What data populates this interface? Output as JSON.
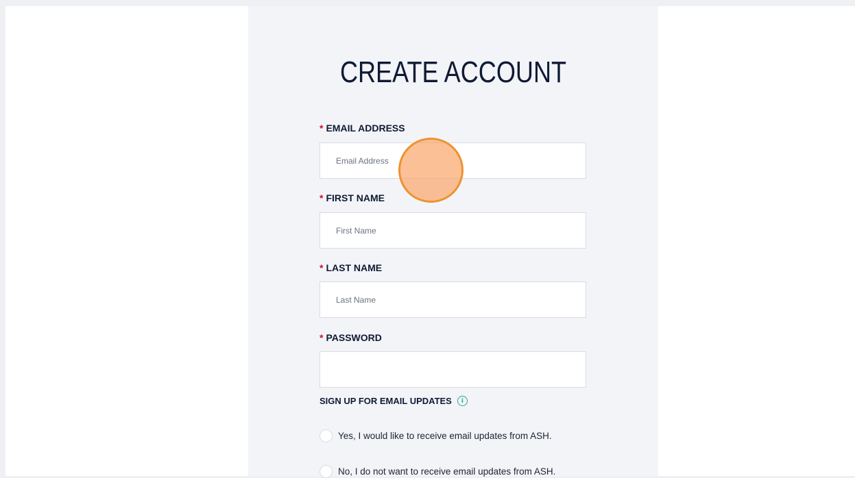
{
  "form": {
    "title": "CREATE ACCOUNT",
    "required_marker": "*",
    "fields": [
      {
        "label": "EMAIL ADDRESS",
        "placeholder": "Email Address",
        "value": ""
      },
      {
        "label": "FIRST NAME",
        "placeholder": "First Name",
        "value": ""
      },
      {
        "label": "LAST NAME",
        "placeholder": "Last Name",
        "value": ""
      },
      {
        "label": "PASSWORD",
        "placeholder": "",
        "value": ""
      }
    ],
    "updates": {
      "label": "SIGN UP FOR EMAIL UPDATES",
      "info_icon": "info-icon",
      "info_glyph": "i",
      "options": [
        {
          "label": "Yes, I would like to receive email updates from ASH.",
          "selected": false
        },
        {
          "label": "No, I do not want to receive email updates from ASH.",
          "selected": false
        }
      ]
    }
  },
  "colors": {
    "page_bg": "#eef0f4",
    "panel_bg": "#f3f4f8",
    "heading": "#0f1a33",
    "required": "#c8102e",
    "info_accent": "#2aa59a",
    "click_indicator": "#ee9230"
  }
}
